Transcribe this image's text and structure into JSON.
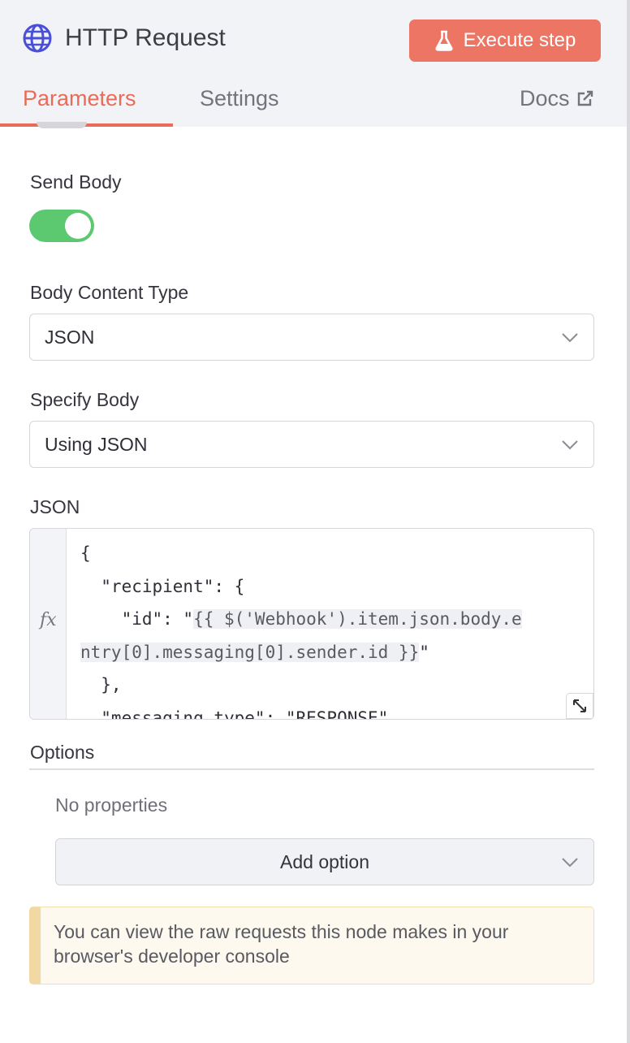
{
  "header": {
    "icon": "globe-icon",
    "title": "HTTP Request",
    "execute_button": {
      "label": "Execute step",
      "icon": "flask-icon"
    },
    "accent_color": "#ed7563"
  },
  "tabs": [
    {
      "label": "Parameters",
      "active": true
    },
    {
      "label": "Settings",
      "active": false
    },
    {
      "label": "Docs",
      "icon": "external-link-icon",
      "active": false
    }
  ],
  "send_body": {
    "label": "Send Body",
    "enabled": true,
    "toggle_color": "#5cc870"
  },
  "body_content_type": {
    "label": "Body Content Type",
    "value": "JSON"
  },
  "specify_body": {
    "label": "Specify Body",
    "value": "Using JSON"
  },
  "json_field": {
    "label": "JSON",
    "fx_label": "fx",
    "lines": {
      "l1": "{",
      "l2": "  \"recipient\": {",
      "l3_prefix": "    \"id\": \"",
      "l3_expr": "{{ $('Webhook').item.json.body.e",
      "l4_expr": "ntry[0].messaging[0].sender.id }}",
      "l4_suffix": "\"",
      "l5": "  },",
      "l6": "  \"messaging_type\": \"RESPONSE\","
    }
  },
  "options": {
    "label": "Options",
    "empty_text": "No properties",
    "add_button": "Add option"
  },
  "notice": {
    "text": "You can view the raw requests this node makes in your browser's developer console"
  }
}
